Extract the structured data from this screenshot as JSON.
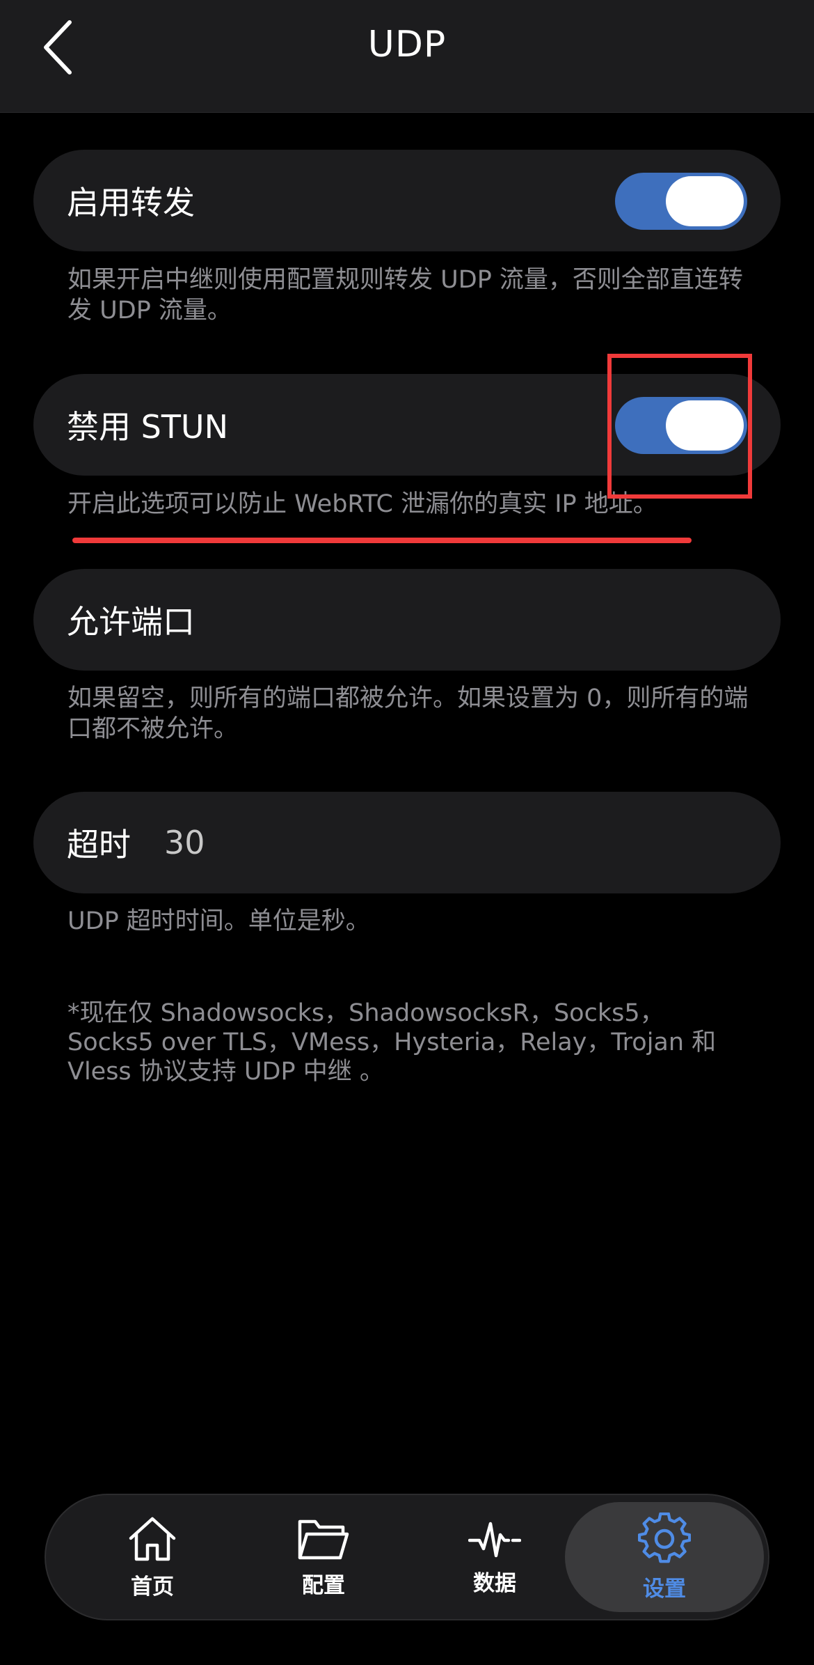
{
  "header": {
    "title": "UDP"
  },
  "settings": {
    "forwarding": {
      "label": "启用转发",
      "enabled": true,
      "description": "如果开启中继则使用配置规则转发 UDP 流量，否则全部直连转发 UDP 流量。"
    },
    "disable_stun": {
      "label": "禁用 STUN",
      "enabled": true,
      "description": "开启此选项可以防止 WebRTC 泄漏你的真实 IP 地址。"
    },
    "allowed_ports": {
      "label": "允许端口",
      "value": "",
      "description": "如果留空，则所有的端口都被允许。如果设置为 0，则所有的端口都不被允许。"
    },
    "timeout": {
      "label": "超时",
      "value": "30",
      "description": "UDP 超时时间。单位是秒。"
    }
  },
  "footnote": "*现在仅 Shadowsocks，ShadowsocksR，Socks5，Socks5 over TLS，VMess，Hysteria，Relay，Trojan 和 Vless 协议支持 UDP 中继 。",
  "tabbar": {
    "tabs": [
      {
        "label": "首页",
        "icon": "home-icon"
      },
      {
        "label": "配置",
        "icon": "folder-icon"
      },
      {
        "label": "数据",
        "icon": "activity-icon"
      },
      {
        "label": "设置",
        "icon": "gear-icon",
        "active": true
      }
    ]
  },
  "colors": {
    "accent": "#3e6fbd",
    "tab_active": "#4f8ce6",
    "annotation": "#f03a3a"
  }
}
